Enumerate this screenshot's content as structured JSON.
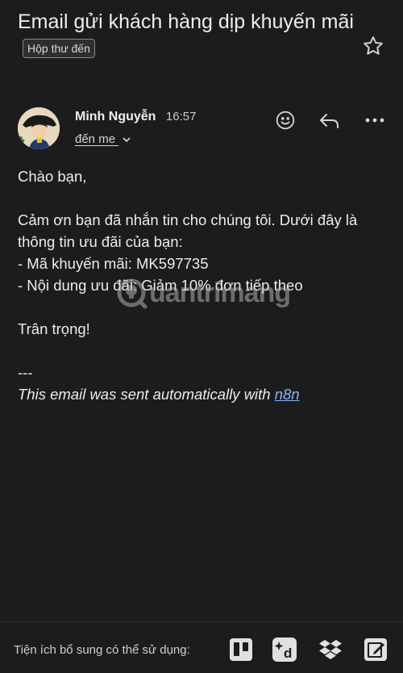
{
  "email": {
    "subject": "Email gửi khách hàng dịp khuyến mãi",
    "label_chip": "Hộp thư đến",
    "sender_name": "Minh Nguyễn",
    "time": "16:57",
    "recipient": "đến me",
    "body": {
      "greeting": "Chào bạn,",
      "line1": "Cảm ơn bạn đã nhắn tin cho chúng tôi. Dưới đây là thông tin ưu đãi của bạn:",
      "line2": "- Mã khuyến mãi: MK597735",
      "line3": "- Nội dung ưu đãi: Giảm 10% đơn tiếp theo",
      "closing": "Trân trọng!",
      "separator": "---",
      "signature_prefix": "This email was sent automatically with ",
      "signature_link": "n8n"
    }
  },
  "watermark": {
    "text": "uantrimang"
  },
  "footer": {
    "label": "Tiện ích bổ sung có thể sử dụng:",
    "addons": [
      "trello-icon",
      "dialpad-icon",
      "dropbox-icon",
      "note-edit-icon"
    ]
  },
  "icons": {
    "star": "star-outline-icon",
    "emoji": "smiley-icon",
    "reply": "reply-icon",
    "more": "more-horizontal-icon",
    "chevron": "chevron-down-icon"
  },
  "colors": {
    "background": "#1c1c1e",
    "text": "#ececec",
    "link": "#8ab4f8"
  }
}
